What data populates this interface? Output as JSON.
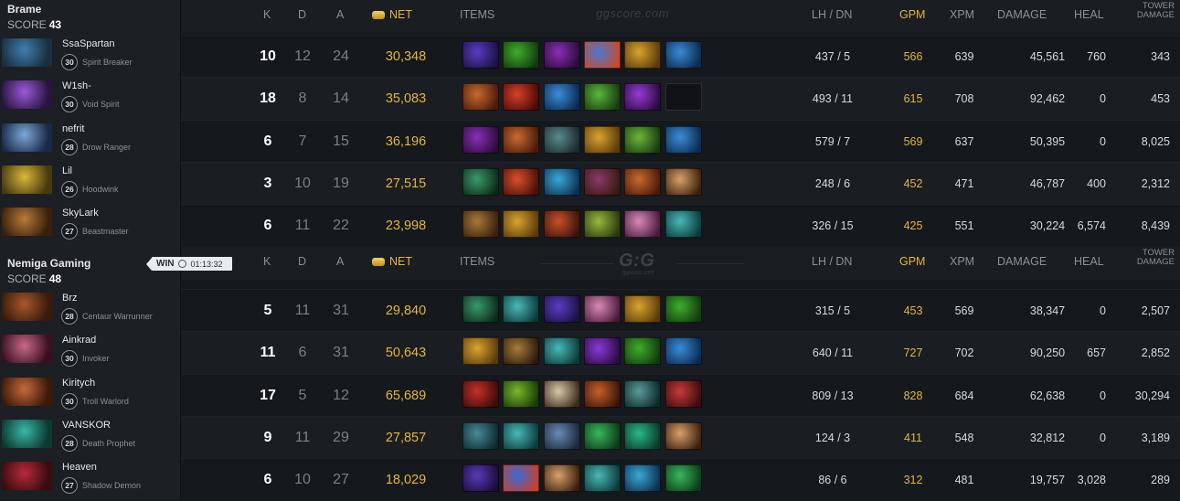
{
  "headers": {
    "k": "K",
    "d": "D",
    "a": "A",
    "net": "NET",
    "items": "ITEMS",
    "lh_dn": "LH / DN",
    "gpm": "GPM",
    "xpm": "XPM",
    "damage": "DAMAGE",
    "heal": "HEAL",
    "tower_damage_1": "TOWER",
    "tower_damage_2": "DAMAGE",
    "watermark_top": "ggscore.com",
    "watermark_mid": "G:G",
    "watermark_mid_sub": "ggscore.com"
  },
  "teams": [
    {
      "name": "Brame",
      "score_label": "SCORE",
      "score": "43",
      "players": [
        {
          "name": "SsaSpartan",
          "level": "30",
          "hero": "Spirit Breaker",
          "k": "10",
          "d": "12",
          "a": "24",
          "net": "30,348",
          "lh_dn": "437 / 5",
          "gpm": "566",
          "xpm": "639",
          "damage": "45,561",
          "heal": "760",
          "tower": "343",
          "portrait": [
            "#3f7fae",
            "#1b2f40"
          ],
          "items": [
            [
              "#5b3cc4",
              "#1a1240"
            ],
            [
              "#3fae2a",
              "#123a10"
            ],
            [
              "#8a2fb8",
              "#2a0d38"
            ],
            [
              "#4a7ad6",
              "#c84a2a"
            ],
            [
              "#d9a42e",
              "#5a3a0c"
            ],
            [
              "#3a8ad8",
              "#0c2a4a"
            ]
          ]
        },
        {
          "name": "W1sh-",
          "level": "30",
          "hero": "Void Spirit",
          "k": "18",
          "d": "8",
          "a": "14",
          "net": "35,083",
          "lh_dn": "493 / 11",
          "gpm": "615",
          "xpm": "708",
          "damage": "92,462",
          "heal": "0",
          "tower": "453",
          "portrait": [
            "#9a5ad8",
            "#2a1440"
          ],
          "items": [
            [
              "#c86a2e",
              "#4a1a0a"
            ],
            [
              "#d8402a",
              "#4a0c08"
            ],
            [
              "#3a8ed8",
              "#0c2a50"
            ],
            [
              "#5ab83a",
              "#1a3a10"
            ],
            [
              "#9a3ad8",
              "#2a0c40"
            ],
            null
          ]
        },
        {
          "name": "nefrit",
          "level": "28",
          "hero": "Drow Ranger",
          "k": "6",
          "d": "7",
          "a": "15",
          "net": "36,196",
          "lh_dn": "579 / 7",
          "gpm": "569",
          "xpm": "637",
          "damage": "50,395",
          "heal": "0",
          "tower": "8,025",
          "portrait": [
            "#7aa8d8",
            "#1a2a48"
          ],
          "items": [
            [
              "#8a2fb8",
              "#2a0d38"
            ],
            [
              "#c86a2e",
              "#4a1a0a"
            ],
            [
              "#5a8a8e",
              "#1a2a2e"
            ],
            [
              "#d9a42e",
              "#5a3a0c"
            ],
            [
              "#6ab83a",
              "#1a3a10"
            ],
            [
              "#3a8ed8",
              "#0c2a50"
            ]
          ]
        },
        {
          "name": "Lil",
          "level": "26",
          "hero": "Hoodwink",
          "k": "3",
          "d": "10",
          "a": "19",
          "net": "27,515",
          "lh_dn": "248 / 6",
          "gpm": "452",
          "xpm": "471",
          "damage": "46,787",
          "heal": "400",
          "tower": "2,312",
          "portrait": [
            "#d8b83a",
            "#4a3a10"
          ],
          "items": [
            [
              "#3a9a6a",
              "#0c2a1a"
            ],
            [
              "#d8502a",
              "#4a100a"
            ],
            [
              "#3aa8d8",
              "#0c3050"
            ],
            [
              "#8a3a6a",
              "#3a1a10"
            ],
            [
              "#c86a2e",
              "#4a1a0a"
            ],
            [
              "#d8a06a",
              "#3a200c"
            ]
          ]
        },
        {
          "name": "SkyLark",
          "level": "27",
          "hero": "Beastmaster",
          "k": "6",
          "d": "11",
          "a": "22",
          "net": "23,998",
          "lh_dn": "326 / 15",
          "gpm": "425",
          "xpm": "551",
          "damage": "30,224",
          "heal": "6,574",
          "tower": "8,439",
          "portrait": [
            "#b87a3a",
            "#3a200c"
          ],
          "items": [
            [
              "#a8783a",
              "#3a200c"
            ],
            [
              "#d9a42e",
              "#5a3a0c"
            ],
            [
              "#c8502a",
              "#3a140a"
            ],
            [
              "#9ab83a",
              "#2a3a10"
            ],
            [
              "#d88ab8",
              "#4a1a3a"
            ],
            [
              "#4ab8b8",
              "#0c3a3a"
            ]
          ]
        }
      ]
    },
    {
      "name": "Nemiga Gaming",
      "score_label": "SCORE",
      "score": "48",
      "win_label": "WIN",
      "duration": "01:13:32",
      "players": [
        {
          "name": "Brz",
          "level": "28",
          "hero": "Centaur Warrunner",
          "k": "5",
          "d": "11",
          "a": "31",
          "net": "29,840",
          "lh_dn": "315 / 5",
          "gpm": "453",
          "xpm": "569",
          "damage": "38,347",
          "heal": "0",
          "tower": "2,507",
          "portrait": [
            "#a85a2a",
            "#3a1a0a"
          ],
          "items": [
            [
              "#3a9a6a",
              "#0c2a1a"
            ],
            [
              "#4ab8b8",
              "#0c3a3a"
            ],
            [
              "#5b3cc4",
              "#1a1240"
            ],
            [
              "#d88ab8",
              "#4a1a3a"
            ],
            [
              "#d9a42e",
              "#5a3a0c"
            ],
            [
              "#3fae2a",
              "#123a10"
            ]
          ]
        },
        {
          "name": "Ainkrad",
          "level": "30",
          "hero": "Invoker",
          "k": "11",
          "d": "6",
          "a": "31",
          "net": "50,643",
          "lh_dn": "640 / 11",
          "gpm": "727",
          "xpm": "702",
          "damage": "90,250",
          "heal": "657",
          "tower": "2,852",
          "portrait": [
            "#c86a8a",
            "#3a1020"
          ],
          "items": [
            [
              "#d9a42e",
              "#5a3a0c"
            ],
            [
              "#a87a3a",
              "#2a1a0c"
            ],
            [
              "#4ab8b8",
              "#0c3a3a"
            ],
            [
              "#8a3ad8",
              "#2a0c40"
            ],
            [
              "#3fae2a",
              "#123a10"
            ],
            [
              "#3a8ed8",
              "#0c2a50"
            ]
          ]
        },
        {
          "name": "Kiritych",
          "level": "30",
          "hero": "Troll Warlord",
          "k": "17",
          "d": "5",
          "a": "12",
          "net": "65,689",
          "lh_dn": "809 / 13",
          "gpm": "828",
          "xpm": "684",
          "damage": "62,638",
          "heal": "0",
          "tower": "30,294",
          "portrait": [
            "#c86a3a",
            "#3a1a0a"
          ],
          "items": [
            [
              "#c8302a",
              "#3a0c0a"
            ],
            [
              "#7ab82a",
              "#1a3a0a"
            ],
            [
              "#d8c8a8",
              "#3a2a1a"
            ],
            [
              "#c8602a",
              "#3a140a"
            ],
            [
              "#5a9a9a",
              "#0c2a2a"
            ],
            [
              "#c83a3a",
              "#3a0c0c"
            ]
          ]
        },
        {
          "name": "VANSKOR",
          "level": "28",
          "hero": "Death Prophet",
          "k": "9",
          "d": "11",
          "a": "29",
          "net": "27,857",
          "lh_dn": "124 / 3",
          "gpm": "411",
          "xpm": "548",
          "damage": "32,812",
          "heal": "0",
          "tower": "3,189",
          "portrait": [
            "#3ab8a8",
            "#0c3a30"
          ],
          "items": [
            [
              "#4a8a9a",
              "#0c2a30"
            ],
            [
              "#4ab8b8",
              "#0c3a3a"
            ],
            [
              "#6a8ab8",
              "#1a2a3a"
            ],
            [
              "#3ab85a",
              "#0c3a1a"
            ],
            [
              "#2ab88a",
              "#0c3a2a"
            ],
            [
              "#d8a06a",
              "#3a200c"
            ]
          ]
        },
        {
          "name": "Heaven",
          "level": "27",
          "hero": "Shadow Demon",
          "k": "6",
          "d": "10",
          "a": "27",
          "net": "18,029",
          "lh_dn": "86 / 6",
          "gpm": "312",
          "xpm": "481",
          "damage": "19,757",
          "heal": "3,028",
          "tower": "289",
          "portrait": [
            "#b82a3a",
            "#3a0c10"
          ],
          "items": [
            [
              "#5a3ab8",
              "#1a0c3a"
            ],
            [
              "#3a6ad8",
              "#c8402a"
            ],
            [
              "#d8a06a",
              "#3a200c"
            ],
            [
              "#4ab8b8",
              "#0c3a3a"
            ],
            [
              "#3aa8d8",
              "#0c3050"
            ],
            [
              "#3ab85a",
              "#0c3a1a"
            ]
          ]
        }
      ]
    }
  ]
}
